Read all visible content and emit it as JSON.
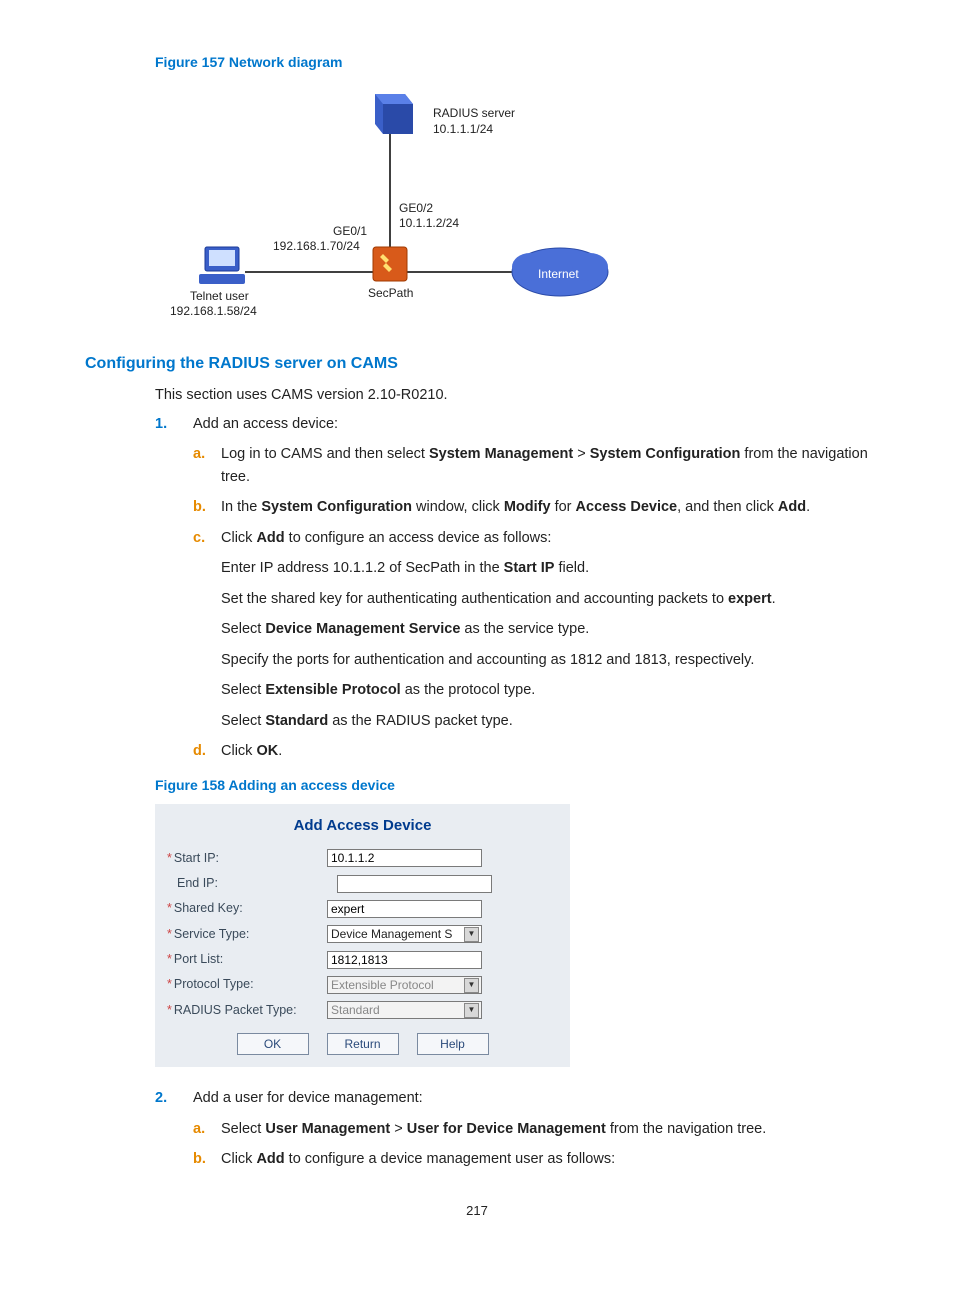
{
  "fig157": {
    "caption": "Figure 157 Network diagram",
    "radius_label1": "RADIUS server",
    "radius_label2": "10.1.1.1/24",
    "ge02_label1": "GE0/2",
    "ge02_label2": "10.1.1.2/24",
    "ge01_label1": "GE0/1",
    "ge01_label2": "192.168.1.70/24",
    "telnet_label1": "Telnet user",
    "telnet_label2": "192.168.1.58/24",
    "secpath_label": "SecPath",
    "internet_label": "Internet"
  },
  "heading": "Configuring the RADIUS server on CAMS",
  "intro": "This section uses CAMS version 2.10-R0210.",
  "step1": {
    "marker": "1.",
    "text": "Add an access device:",
    "a": {
      "marker": "a.",
      "pre": "Log in to CAMS and then select ",
      "b1": "System Management",
      "mid": " > ",
      "b2": "System Configuration",
      "post": " from the navigation tree."
    },
    "b": {
      "marker": "b.",
      "pre": "In the ",
      "b1": "System Configuration",
      "mid1": " window, click ",
      "b2": "Modify",
      "mid2": " for ",
      "b3": "Access Device",
      "mid3": ", and then click ",
      "b4": "Add",
      "post": "."
    },
    "c": {
      "marker": "c.",
      "pre": "Click ",
      "b1": "Add",
      "post": " to configure an access device as follows:",
      "l1_pre": "Enter IP address 10.1.1.2 of SecPath in the ",
      "l1_b": "Start IP",
      "l1_post": " field.",
      "l2_pre": "Set the shared key for authenticating authentication and accounting packets to ",
      "l2_b": "expert",
      "l2_post": ".",
      "l3_pre": "Select ",
      "l3_b": "Device Management Service",
      "l3_post": " as the service type.",
      "l4": "Specify the ports for authentication and accounting as 1812 and 1813, respectively.",
      "l5_pre": "Select ",
      "l5_b": "Extensible Protocol",
      "l5_post": " as the protocol type.",
      "l6_pre": "Select ",
      "l6_b": "Standard",
      "l6_post": " as the RADIUS packet type."
    },
    "d": {
      "marker": "d.",
      "pre": "Click ",
      "b1": "OK",
      "post": "."
    }
  },
  "fig158": {
    "caption": "Figure 158 Adding an access device",
    "title": "Add Access Device",
    "rows": {
      "start_ip": {
        "label": "Start IP:",
        "value": "10.1.1.2",
        "required": true
      },
      "end_ip": {
        "label": "End IP:",
        "value": "",
        "required": false
      },
      "shared_key": {
        "label": "Shared Key:",
        "value": "expert",
        "required": true
      },
      "service_type": {
        "label": "Service Type:",
        "value": "Device Management S",
        "required": true
      },
      "port_list": {
        "label": "Port List:",
        "value": "1812,1813",
        "required": true
      },
      "protocol_type": {
        "label": "Protocol Type:",
        "value": "Extensible Protocol",
        "required": true
      },
      "radius_packet_type": {
        "label": "RADIUS Packet Type:",
        "value": "Standard",
        "required": true
      }
    },
    "buttons": {
      "ok": "OK",
      "return": "Return",
      "help": "Help"
    }
  },
  "step2": {
    "marker": "2.",
    "text": "Add a user for device management:",
    "a": {
      "marker": "a.",
      "pre": "Select ",
      "b1": "User Management",
      "mid": " > ",
      "b2": "User for Device Management",
      "post": " from the navigation tree."
    },
    "b": {
      "marker": "b.",
      "pre": "Click ",
      "b1": "Add",
      "post": " to configure a device management user as follows:"
    }
  },
  "page_number": "217"
}
